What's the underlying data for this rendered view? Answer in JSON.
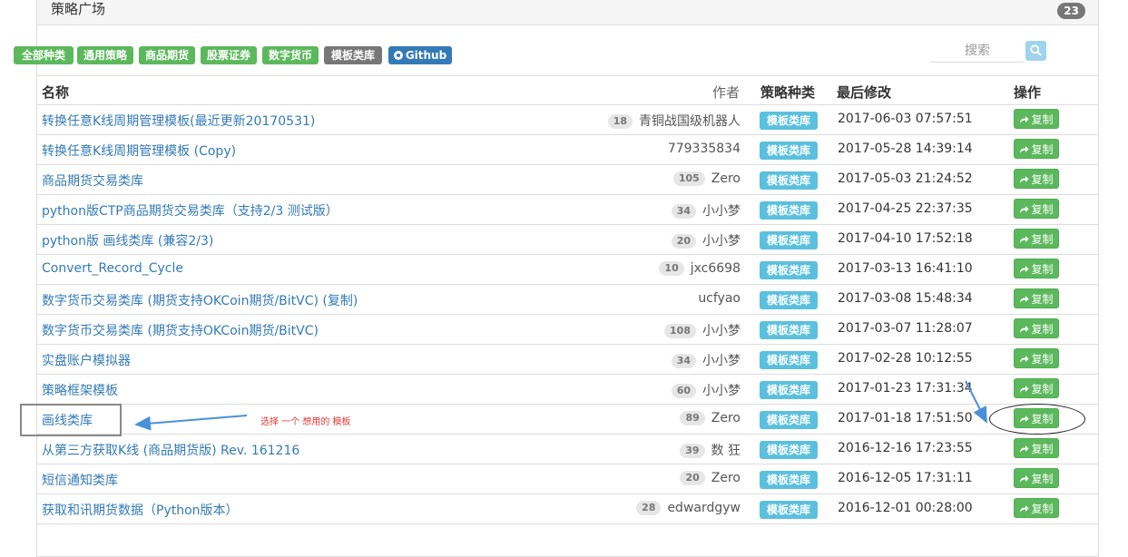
{
  "panel": {
    "title": "策略广场",
    "count": "23"
  },
  "filters": [
    "全部种类",
    "通用策略",
    "商品期货",
    "股票证券",
    "数字货币",
    "模板类库",
    "Github"
  ],
  "search": {
    "placeholder": "搜索"
  },
  "table": {
    "headers": {
      "name": "名称",
      "author": "作者",
      "type": "策略种类",
      "modified": "最后修改",
      "action": "操作"
    },
    "copy_label": "复制",
    "rows": [
      {
        "name": "转换任意K线周期管理模板(最近更新20170531)",
        "score": "18",
        "author": "青铜战国级机器人",
        "type": "模板类库",
        "modified": "2017-06-03 07:57:51"
      },
      {
        "name": "转换任意K线周期管理模板 (Copy)",
        "score": "",
        "author": "779335834",
        "type": "模板类库",
        "modified": "2017-05-28 14:39:14"
      },
      {
        "name": "商品期货交易类库",
        "score": "105",
        "author": "Zero",
        "type": "模板类库",
        "modified": "2017-05-03 21:24:52"
      },
      {
        "name": "python版CTP商品期货交易类库（支持2/3 测试版）",
        "score": "34",
        "author": "小小梦",
        "type": "模板类库",
        "modified": "2017-04-25 22:37:35"
      },
      {
        "name": "python版 画线类库 (兼容2/3)",
        "score": "20",
        "author": "小小梦",
        "type": "模板类库",
        "modified": "2017-04-10 17:52:18"
      },
      {
        "name": "Convert_Record_Cycle",
        "score": "10",
        "author": "jxc6698",
        "type": "模板类库",
        "modified": "2017-03-13 16:41:10"
      },
      {
        "name": "数字货币交易类库 (期货支持OKCoin期货/BitVC) (复制)",
        "score": "",
        "author": "ucfyao",
        "type": "模板类库",
        "modified": "2017-03-08 15:48:34"
      },
      {
        "name": "数字货币交易类库 (期货支持OKCoin期货/BitVC)",
        "score": "108",
        "author": "小小梦",
        "type": "模板类库",
        "modified": "2017-03-07 11:28:07"
      },
      {
        "name": "实盘账户模拟器",
        "score": "34",
        "author": "小小梦",
        "type": "模板类库",
        "modified": "2017-02-28 10:12:55"
      },
      {
        "name": "策略框架模板",
        "score": "60",
        "author": "小小梦",
        "type": "模板类库",
        "modified": "2017-01-23 17:31:34"
      },
      {
        "name": "画线类库",
        "score": "89",
        "author": "Zero",
        "type": "模板类库",
        "modified": "2017-01-18 17:51:50"
      },
      {
        "name": "从第三方获取K线 (商品期货版) Rev. 161216",
        "score": "39",
        "author": "数 狂",
        "type": "模板类库",
        "modified": "2016-12-16 17:23:55"
      },
      {
        "name": "短信通知类库",
        "score": "20",
        "author": "Zero",
        "type": "模板类库",
        "modified": "2016-12-05 17:31:11"
      },
      {
        "name": "获取和讯期货数据（Python版本）",
        "score": "28",
        "author": "edwardgyw",
        "type": "模板类库",
        "modified": "2016-12-01 00:28:00"
      }
    ]
  },
  "annotation": {
    "text": "选择 一个 想用的 模板"
  },
  "colors": {
    "link": "#337ab7",
    "green": "#5cb85c",
    "info": "#5bc0de",
    "gray": "#777777",
    "annotation_red": "#e53935",
    "arrow_blue": "#4a90d9"
  }
}
